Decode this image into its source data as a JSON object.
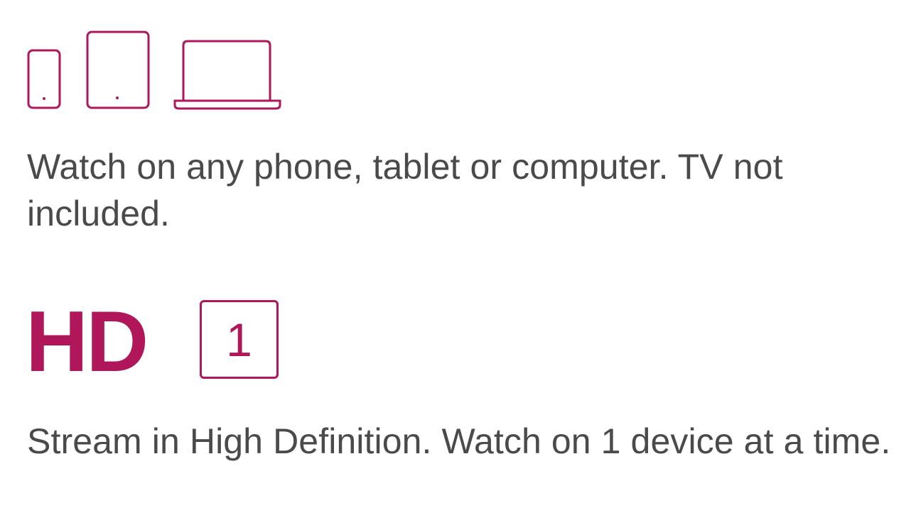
{
  "plan_features": {
    "devices": {
      "icons": [
        "phone-icon",
        "tablet-icon",
        "laptop-icon"
      ],
      "description": "Watch on any phone, tablet or computer. TV not included."
    },
    "quality": {
      "label": "HD",
      "screens": "1",
      "description": "Stream in High Definition. Watch on 1 device at a time."
    }
  },
  "colors": {
    "accent": "#b0175a",
    "text": "#4a4a4a",
    "background": "#ffffff"
  }
}
